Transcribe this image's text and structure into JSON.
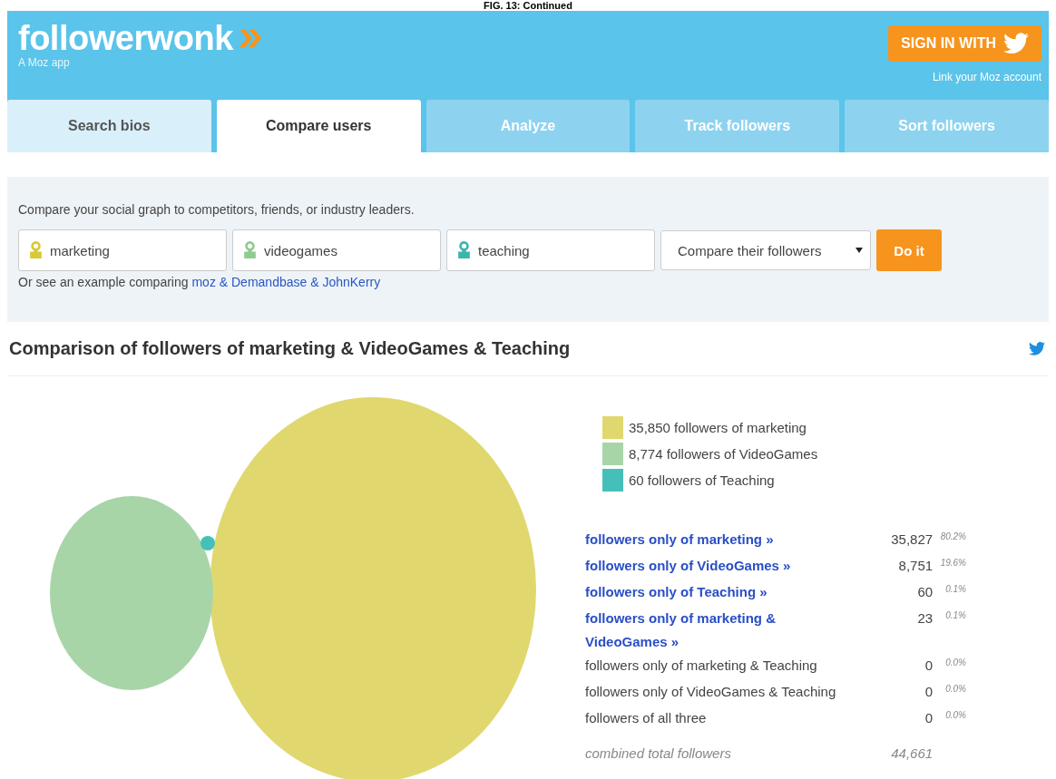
{
  "caption": "FIG. 13: Continued",
  "header": {
    "logo": "followerwonk",
    "tagline": "A Moz app",
    "sign_in": "SIGN IN WITH",
    "moz_link": "Link your Moz account"
  },
  "tabs": [
    {
      "label": "Search bios",
      "selected": false
    },
    {
      "label": "Compare users",
      "selected": true
    },
    {
      "label": "Analyze",
      "selected": false
    },
    {
      "label": "Track followers",
      "selected": false
    },
    {
      "label": "Sort followers",
      "selected": false
    }
  ],
  "compare": {
    "intro": "Compare your social graph to competitors, friends, or industry leaders.",
    "users": [
      {
        "value": "marketing",
        "color": "#d9c934"
      },
      {
        "value": "videogames",
        "color": "#8fcc8f"
      },
      {
        "value": "teaching",
        "color": "#3bb5ad"
      }
    ],
    "mode": "Compare their followers",
    "button": "Do it",
    "example_prefix": "Or see an example comparing",
    "example_link": "moz & Demandbase & JohnKerry"
  },
  "result": {
    "title": "Comparison of followers of marketing & VideoGames & Teaching",
    "legend": [
      {
        "label": "35,850 followers of marketing",
        "color": "#e0d86e"
      },
      {
        "label": "8,774 followers of VideoGames",
        "color": "#a8d5a8"
      },
      {
        "label": "60 followers of Teaching",
        "color": "#45c0b8"
      }
    ],
    "rows": [
      {
        "kind": "link",
        "label": "followers only of marketing »",
        "count": "35,827",
        "percent": "80.2%"
      },
      {
        "kind": "link",
        "label": "followers only of VideoGames »",
        "count": "8,751",
        "percent": "19.6%"
      },
      {
        "kind": "link",
        "label": "followers only of Teaching »",
        "count": "60",
        "percent": "0.1%"
      },
      {
        "kind": "link",
        "label": "followers only of marketing & VideoGames »",
        "count": "23",
        "percent": "0.1%"
      },
      {
        "kind": "plain",
        "label": "followers only of marketing & Teaching",
        "count": "0",
        "percent": "0.0%"
      },
      {
        "kind": "plain",
        "label": "followers only of VideoGames & Teaching",
        "count": "0",
        "percent": "0.0%"
      },
      {
        "kind": "plain",
        "label": "followers of all three",
        "count": "0",
        "percent": "0.0%"
      },
      {
        "kind": "total",
        "label": "combined total followers",
        "count": "44,661"
      }
    ]
  }
}
